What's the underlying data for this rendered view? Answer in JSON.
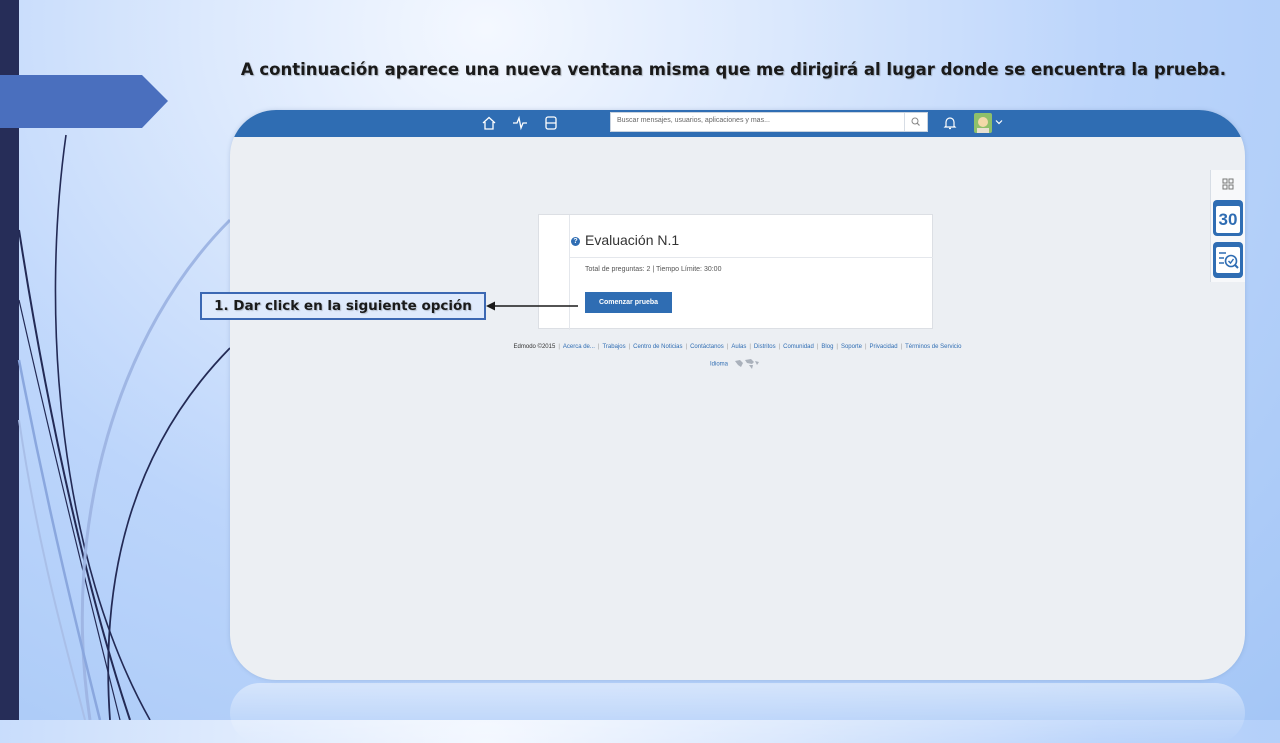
{
  "slide": {
    "title": "A continuación aparece una nueva ventana misma que me dirigirá al lugar donde se encuentra la prueba.",
    "callout": "1. Dar click en la siguiente opción"
  },
  "app": {
    "nav": {
      "icons": [
        "home-icon",
        "activity-icon",
        "backpack-icon",
        "bell-icon",
        "search-icon",
        "chevron-down-icon"
      ],
      "search_placeholder": "Buscar mensajes, usuarios, aplicaciones y mas..."
    },
    "side_widget": {
      "calendar_day": "30",
      "icons": [
        "grid-icon",
        "calendar-icon",
        "grade-check-icon"
      ]
    },
    "quiz": {
      "title": "Evaluación N.1",
      "meta": "Total de preguntas: 2   |   Tiempo Límite: 30:00",
      "start_label": "Comenzar prueba"
    },
    "footer": {
      "copyright": "Edmodo ©2015",
      "links": [
        "Acerca de...",
        "Trabajos",
        "Centro de Noticias",
        "Contáctanos",
        "Aulas",
        "Distritos",
        "Comunidad",
        "Blog",
        "Soporte",
        "Privacidad",
        "Términos de Servicio"
      ],
      "language": "Idioma"
    }
  },
  "colors": {
    "nav_blue": "#2f6db3",
    "slide_accent": "#262d58",
    "callout_border": "#3c68b3"
  }
}
